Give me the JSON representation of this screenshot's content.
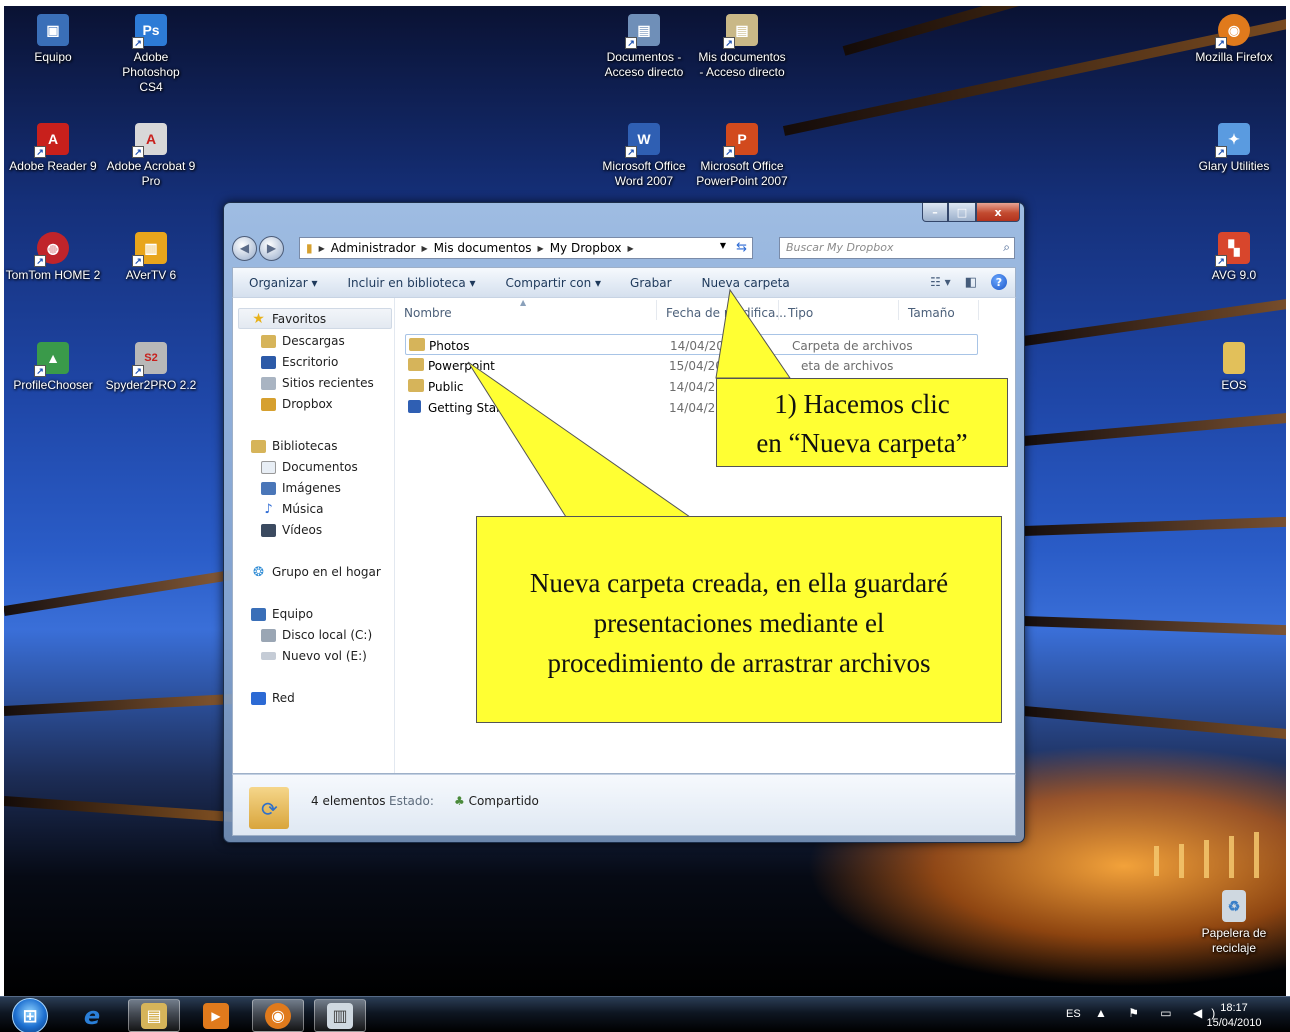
{
  "desktop": {
    "icons": [
      {
        "label": "Equipo",
        "icon": "computer-icon",
        "color": "#3a6fb8",
        "glyph": "▣"
      },
      {
        "label": "Adobe Photoshop CS4",
        "icon": "photoshop-icon",
        "color": "#2d7bd6",
        "glyph": "Ps"
      },
      {
        "label": "Documentos - Acceso directo",
        "icon": "documents-shortcut-icon",
        "color": "#6f8fb8",
        "glyph": "▤"
      },
      {
        "label": "Mis documentos - Acceso directo",
        "icon": "my-documents-shortcut-icon",
        "color": "#c9b887",
        "glyph": "▤"
      },
      {
        "label": "Mozilla Firefox",
        "icon": "firefox-icon",
        "color": "#e07a1c",
        "glyph": "◉"
      },
      {
        "label": "Adobe Reader 9",
        "icon": "adobe-reader-icon",
        "color": "#c8201c",
        "glyph": "A"
      },
      {
        "label": "Adobe Acrobat 9 Pro",
        "icon": "adobe-acrobat-icon",
        "color": "#d8d8d8",
        "glyph": "A"
      },
      {
        "label": "Microsoft Office Word 2007",
        "icon": "word-icon",
        "color": "#2f5fb3",
        "glyph": "W"
      },
      {
        "label": "Microsoft Office PowerPoint 2007",
        "icon": "powerpoint-icon",
        "color": "#d24a1d",
        "glyph": "P"
      },
      {
        "label": "Glary Utilities",
        "icon": "glary-utilities-icon",
        "color": "#5a9be0",
        "glyph": "✦"
      },
      {
        "label": "TomTom HOME 2",
        "icon": "tomtom-icon",
        "color": "#c0242a",
        "glyph": "◍"
      },
      {
        "label": "AVerTV 6",
        "icon": "avertv-icon",
        "color": "#e8a51c",
        "glyph": "▥"
      },
      {
        "label": "AVG 9.0",
        "icon": "avg-icon",
        "color": "#d8462c",
        "glyph": "▚"
      },
      {
        "label": "ProfileChooser",
        "icon": "profilechooser-icon",
        "color": "#3a9a4a",
        "glyph": "▲"
      },
      {
        "label": "Spyder2PRO 2.2",
        "icon": "spyder-icon",
        "color": "#b8b8b8",
        "glyph": "S2"
      },
      {
        "label": "EOS",
        "icon": "folder-icon",
        "color": "#e2c05a",
        "glyph": ""
      },
      {
        "label": "Papelera de reciclaje",
        "icon": "recycle-bin-icon",
        "color": "#cfd8e0",
        "glyph": "♻"
      }
    ]
  },
  "window": {
    "controls": {
      "minimize": "–",
      "maximize": "□",
      "close": "x"
    },
    "breadcrumb": [
      "Administrador",
      "Mis documentos",
      "My Dropbox"
    ],
    "search_placeholder": "Buscar My Dropbox",
    "toolbar": {
      "organize": "Organizar ▾",
      "include": "Incluir en biblioteca ▾",
      "share": "Compartir con ▾",
      "burn": "Grabar",
      "new_folder": "Nueva carpeta"
    },
    "nav": {
      "favorites": "Favoritos",
      "downloads": "Descargas",
      "desktop": "Escritorio",
      "recent": "Sitios recientes",
      "dropbox": "Dropbox",
      "libraries": "Bibliotecas",
      "documents": "Documentos",
      "images": "Imágenes",
      "music": "Música",
      "videos": "Vídeos",
      "homegroup": "Grupo en el hogar",
      "computer": "Equipo",
      "local_disk": "Disco local (C:)",
      "new_volume": "Nuevo vol (E:)",
      "network": "Red"
    },
    "columns": {
      "name": "Nombre",
      "date": "Fecha de modifica...",
      "type": "Tipo",
      "size": "Tamaño"
    },
    "files": [
      {
        "name": "Photos",
        "date": "14/04/2010 21",
        "type": "Carpeta de archivos"
      },
      {
        "name": "Powerpoint",
        "date": "15/04/2010 16:5",
        "type": "eta de archivos"
      },
      {
        "name": "Public",
        "date": "14/04/20",
        "type": ""
      },
      {
        "name": "Getting Star",
        "date": "14/04/20",
        "type": ""
      }
    ],
    "status": {
      "count": "4 elementos",
      "estado_label": "Estado:",
      "estado_value": "Compartido"
    }
  },
  "callouts": {
    "step1_line1": "1) Hacemos clic",
    "step1_line2": "en “Nueva carpeta”",
    "created_line1": "Nueva carpeta creada, en ella guardaré",
    "created_line2": "presentaciones mediante el",
    "created_line3": "procedimiento de arrastrar archivos"
  },
  "taskbar": {
    "apps": [
      {
        "icon": "internet-explorer-icon",
        "glyph": "e",
        "color": "#2a7fd8"
      },
      {
        "icon": "windows-explorer-icon",
        "glyph": "▤",
        "color": "#d6b45a"
      },
      {
        "icon": "media-player-icon",
        "glyph": "▶",
        "color": "#e07a1c"
      },
      {
        "icon": "firefox-icon",
        "glyph": "◉",
        "color": "#e07a1c"
      },
      {
        "icon": "notes-icon",
        "glyph": "▥",
        "color": "#cfd8e0"
      }
    ],
    "language": "ES",
    "tray_icons": "▲ ⚑ ▭ ◀)",
    "time": "18:17",
    "date": "15/04/2010"
  }
}
